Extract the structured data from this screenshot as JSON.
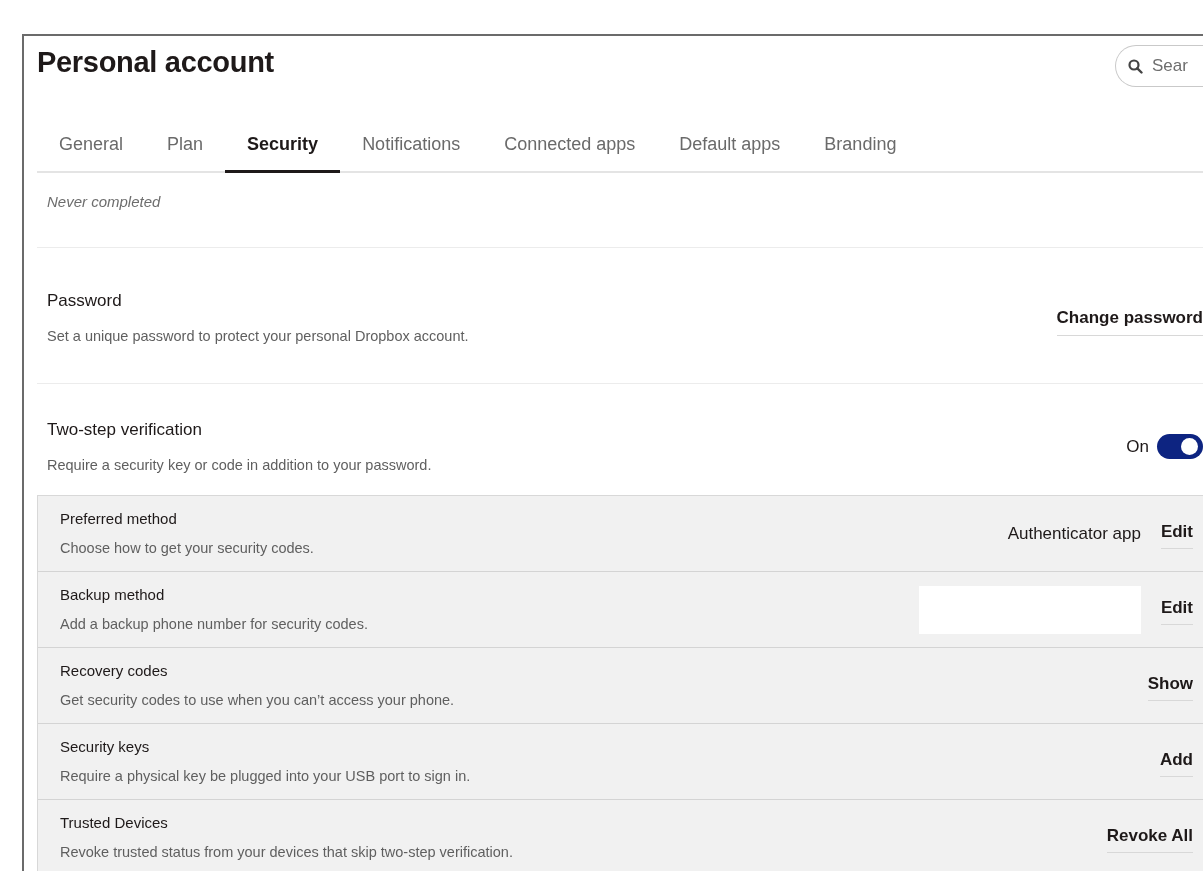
{
  "header": {
    "title": "Personal account",
    "search": {
      "placeholder": "Sear"
    }
  },
  "tabs": [
    {
      "label": "General",
      "selected": false
    },
    {
      "label": "Plan",
      "selected": false
    },
    {
      "label": "Security",
      "selected": true
    },
    {
      "label": "Notifications",
      "selected": false
    },
    {
      "label": "Connected apps",
      "selected": false
    },
    {
      "label": "Default apps",
      "selected": false
    },
    {
      "label": "Branding",
      "selected": false
    }
  ],
  "checkup": {
    "status": "Never completed"
  },
  "password": {
    "title": "Password",
    "description": "Set a unique password to protect your personal Dropbox account.",
    "action": "Change password"
  },
  "two_step": {
    "title": "Two-step verification",
    "description": "Require a security key or code in addition to your password.",
    "toggle_label": "On",
    "on": true
  },
  "methods": [
    {
      "kind": "value",
      "title": "Preferred method",
      "description": "Choose how to get your security codes.",
      "value": "Authenticator app",
      "action": "Edit"
    },
    {
      "kind": "blank",
      "title": "Backup method",
      "description": "Add a backup phone number for security codes.",
      "action": "Edit"
    },
    {
      "kind": "plain",
      "title": "Recovery codes",
      "description": "Get security codes to use when you can’t access your phone.",
      "action": "Show"
    },
    {
      "kind": "plain",
      "title": "Security keys",
      "description": "Require a physical key be plugged into your USB port to sign in.",
      "action": "Add"
    },
    {
      "kind": "plain",
      "title": "Trusted Devices",
      "description": "Revoke trusted status from your devices that skip two-step verification.",
      "action": "Revoke All"
    }
  ]
}
